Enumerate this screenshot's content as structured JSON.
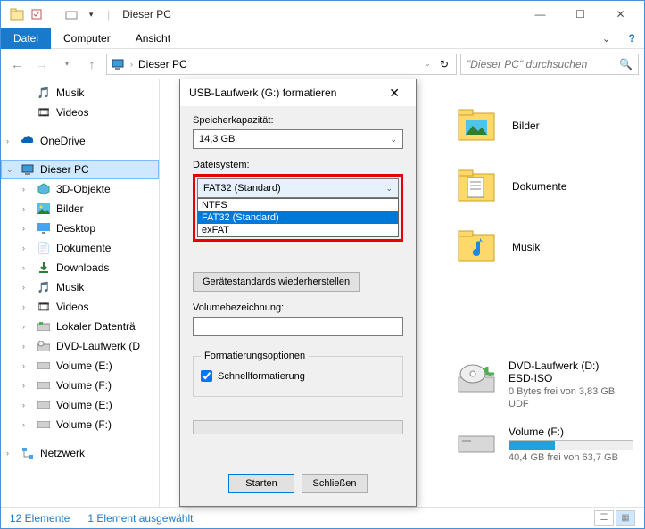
{
  "titlebar": {
    "title": "Dieser PC"
  },
  "ribbon": {
    "file": "Datei",
    "computer": "Computer",
    "view": "Ansicht"
  },
  "addrbar": {
    "location": "Dieser PC",
    "search_placeholder": "\"Dieser PC\" durchsuchen"
  },
  "tree": {
    "music": "Musik",
    "videos": "Videos",
    "onedrive": "OneDrive",
    "thispc": "Dieser PC",
    "objects3d": "3D-Objekte",
    "pictures": "Bilder",
    "desktop": "Desktop",
    "documents": "Dokumente",
    "downloads": "Downloads",
    "music2": "Musik",
    "videos2": "Videos",
    "localdisk": "Lokaler Datenträ",
    "dvd": "DVD-Laufwerk (D",
    "volE": "Volume (E:)",
    "volF": "Volume (F:)",
    "volE2": "Volume (E:)",
    "volF2": "Volume (F:)",
    "network": "Netzwerk"
  },
  "main": {
    "pictures": "Bilder",
    "documents": "Dokumente",
    "music": "Musik",
    "dvd_label": "DVD-Laufwerk (D:) ESD-ISO",
    "dvd_sub": "0 Bytes frei von 3,83 GB",
    "dvd_fs": "UDF",
    "volF_label": "Volume (F:)",
    "volF_sub": "40,4 GB frei von 63,7 GB"
  },
  "status": {
    "count": "12 Elemente",
    "selected": "1 Element ausgewählt"
  },
  "dialog": {
    "title": "USB-Laufwerk (G:) formatieren",
    "capacity_label": "Speicherkapazität:",
    "capacity_value": "14,3 GB",
    "fs_label": "Dateisystem:",
    "fs_value": "FAT32 (Standard)",
    "fs_options": {
      "ntfs": "NTFS",
      "fat32": "FAT32 (Standard)",
      "exfat": "exFAT"
    },
    "alloc_label": "",
    "restore": "Gerätestandards wiederherstellen",
    "volname_label": "Volumebezeichnung:",
    "volname_value": "",
    "options_label": "Formatierungsoptionen",
    "quick": "Schnellformatierung",
    "start": "Starten",
    "close": "Schließen"
  }
}
